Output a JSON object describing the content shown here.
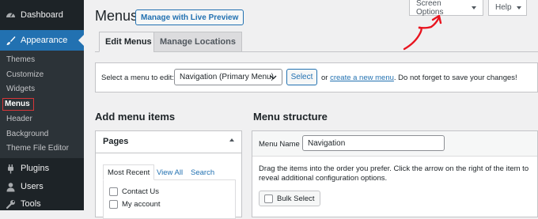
{
  "sidebar": {
    "dashboard": "Dashboard",
    "appearance": "Appearance",
    "submenu": [
      "Themes",
      "Customize",
      "Widgets",
      "Menus",
      "Header",
      "Background",
      "Theme File Editor"
    ],
    "plugins": "Plugins",
    "users": "Users",
    "tools": "Tools"
  },
  "top_tabs": {
    "screen_options": "Screen Options",
    "help": "Help"
  },
  "header": {
    "title": "Menus",
    "live_preview": "Manage with Live Preview"
  },
  "tabs": [
    "Edit Menus",
    "Manage Locations"
  ],
  "select_menu": {
    "label": "Select a menu to edit:",
    "selected": "Navigation (Primary Menu)",
    "button": "Select",
    "or_text": "or",
    "create_link": "create a new menu",
    "hint_rest": ". Do not forget to save your changes!"
  },
  "add_items": {
    "heading": "Add menu items",
    "pages_title": "Pages",
    "tabs": [
      "Most Recent",
      "View All",
      "Search"
    ],
    "items": [
      "Contact Us",
      "My account"
    ]
  },
  "structure": {
    "heading": "Menu structure",
    "name_label": "Menu Name",
    "name_value": "Navigation",
    "help": "Drag the items into the order you prefer. Click the arrow on the right of the item to reveal additional configuration options.",
    "bulk_select": "Bulk Select"
  },
  "colors": {
    "sidebar": "#1d2327",
    "accent": "#2271b1",
    "annotation": "#e8141f"
  }
}
